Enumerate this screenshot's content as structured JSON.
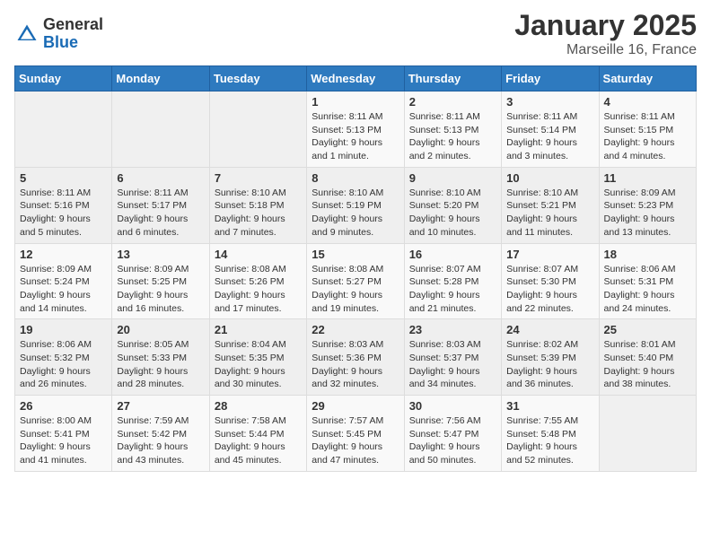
{
  "header": {
    "logo_general": "General",
    "logo_blue": "Blue",
    "title": "January 2025",
    "subtitle": "Marseille 16, France"
  },
  "calendar": {
    "days_of_week": [
      "Sunday",
      "Monday",
      "Tuesday",
      "Wednesday",
      "Thursday",
      "Friday",
      "Saturday"
    ],
    "weeks": [
      [
        {
          "day": "",
          "info": ""
        },
        {
          "day": "",
          "info": ""
        },
        {
          "day": "",
          "info": ""
        },
        {
          "day": "1",
          "info": "Sunrise: 8:11 AM\nSunset: 5:13 PM\nDaylight: 9 hours and 1 minute."
        },
        {
          "day": "2",
          "info": "Sunrise: 8:11 AM\nSunset: 5:13 PM\nDaylight: 9 hours and 2 minutes."
        },
        {
          "day": "3",
          "info": "Sunrise: 8:11 AM\nSunset: 5:14 PM\nDaylight: 9 hours and 3 minutes."
        },
        {
          "day": "4",
          "info": "Sunrise: 8:11 AM\nSunset: 5:15 PM\nDaylight: 9 hours and 4 minutes."
        }
      ],
      [
        {
          "day": "5",
          "info": "Sunrise: 8:11 AM\nSunset: 5:16 PM\nDaylight: 9 hours and 5 minutes."
        },
        {
          "day": "6",
          "info": "Sunrise: 8:11 AM\nSunset: 5:17 PM\nDaylight: 9 hours and 6 minutes."
        },
        {
          "day": "7",
          "info": "Sunrise: 8:10 AM\nSunset: 5:18 PM\nDaylight: 9 hours and 7 minutes."
        },
        {
          "day": "8",
          "info": "Sunrise: 8:10 AM\nSunset: 5:19 PM\nDaylight: 9 hours and 9 minutes."
        },
        {
          "day": "9",
          "info": "Sunrise: 8:10 AM\nSunset: 5:20 PM\nDaylight: 9 hours and 10 minutes."
        },
        {
          "day": "10",
          "info": "Sunrise: 8:10 AM\nSunset: 5:21 PM\nDaylight: 9 hours and 11 minutes."
        },
        {
          "day": "11",
          "info": "Sunrise: 8:09 AM\nSunset: 5:23 PM\nDaylight: 9 hours and 13 minutes."
        }
      ],
      [
        {
          "day": "12",
          "info": "Sunrise: 8:09 AM\nSunset: 5:24 PM\nDaylight: 9 hours and 14 minutes."
        },
        {
          "day": "13",
          "info": "Sunrise: 8:09 AM\nSunset: 5:25 PM\nDaylight: 9 hours and 16 minutes."
        },
        {
          "day": "14",
          "info": "Sunrise: 8:08 AM\nSunset: 5:26 PM\nDaylight: 9 hours and 17 minutes."
        },
        {
          "day": "15",
          "info": "Sunrise: 8:08 AM\nSunset: 5:27 PM\nDaylight: 9 hours and 19 minutes."
        },
        {
          "day": "16",
          "info": "Sunrise: 8:07 AM\nSunset: 5:28 PM\nDaylight: 9 hours and 21 minutes."
        },
        {
          "day": "17",
          "info": "Sunrise: 8:07 AM\nSunset: 5:30 PM\nDaylight: 9 hours and 22 minutes."
        },
        {
          "day": "18",
          "info": "Sunrise: 8:06 AM\nSunset: 5:31 PM\nDaylight: 9 hours and 24 minutes."
        }
      ],
      [
        {
          "day": "19",
          "info": "Sunrise: 8:06 AM\nSunset: 5:32 PM\nDaylight: 9 hours and 26 minutes."
        },
        {
          "day": "20",
          "info": "Sunrise: 8:05 AM\nSunset: 5:33 PM\nDaylight: 9 hours and 28 minutes."
        },
        {
          "day": "21",
          "info": "Sunrise: 8:04 AM\nSunset: 5:35 PM\nDaylight: 9 hours and 30 minutes."
        },
        {
          "day": "22",
          "info": "Sunrise: 8:03 AM\nSunset: 5:36 PM\nDaylight: 9 hours and 32 minutes."
        },
        {
          "day": "23",
          "info": "Sunrise: 8:03 AM\nSunset: 5:37 PM\nDaylight: 9 hours and 34 minutes."
        },
        {
          "day": "24",
          "info": "Sunrise: 8:02 AM\nSunset: 5:39 PM\nDaylight: 9 hours and 36 minutes."
        },
        {
          "day": "25",
          "info": "Sunrise: 8:01 AM\nSunset: 5:40 PM\nDaylight: 9 hours and 38 minutes."
        }
      ],
      [
        {
          "day": "26",
          "info": "Sunrise: 8:00 AM\nSunset: 5:41 PM\nDaylight: 9 hours and 41 minutes."
        },
        {
          "day": "27",
          "info": "Sunrise: 7:59 AM\nSunset: 5:42 PM\nDaylight: 9 hours and 43 minutes."
        },
        {
          "day": "28",
          "info": "Sunrise: 7:58 AM\nSunset: 5:44 PM\nDaylight: 9 hours and 45 minutes."
        },
        {
          "day": "29",
          "info": "Sunrise: 7:57 AM\nSunset: 5:45 PM\nDaylight: 9 hours and 47 minutes."
        },
        {
          "day": "30",
          "info": "Sunrise: 7:56 AM\nSunset: 5:47 PM\nDaylight: 9 hours and 50 minutes."
        },
        {
          "day": "31",
          "info": "Sunrise: 7:55 AM\nSunset: 5:48 PM\nDaylight: 9 hours and 52 minutes."
        },
        {
          "day": "",
          "info": ""
        }
      ]
    ]
  }
}
